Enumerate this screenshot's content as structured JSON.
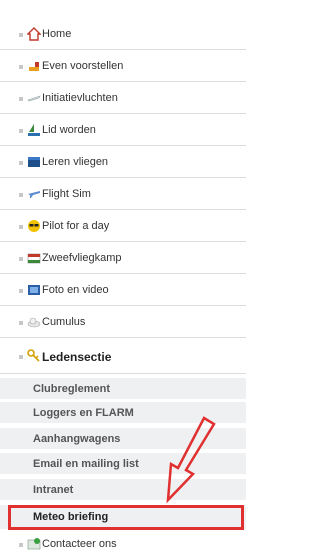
{
  "menu": {
    "items": [
      {
        "label": "Home",
        "icon": "house-icon"
      },
      {
        "label": "Even voorstellen",
        "icon": "plane-icon"
      },
      {
        "label": "Initiatievluchten",
        "icon": "glider-icon"
      },
      {
        "label": "Lid worden",
        "icon": "sailboat-icon"
      },
      {
        "label": "Leren vliegen",
        "icon": "book-icon"
      },
      {
        "label": "Flight Sim",
        "icon": "airplane-icon"
      },
      {
        "label": "Pilot for a day",
        "icon": "sunglasses-icon"
      },
      {
        "label": "Zweefvliegkamp",
        "icon": "flag-icon"
      },
      {
        "label": "Foto en video",
        "icon": "photo-icon"
      },
      {
        "label": "Cumulus",
        "icon": "cloud-icon"
      },
      {
        "label": "Ledensectie",
        "icon": "key-icon"
      },
      {
        "label": "Contacteer ons",
        "icon": "contact-icon"
      }
    ],
    "subitems": [
      {
        "label": "Clubreglement"
      },
      {
        "label": "Loggers en FLARM"
      },
      {
        "label": "Aanhangwagens"
      },
      {
        "label": "Email en mailing list"
      },
      {
        "label": "Intranet"
      },
      {
        "label": "Meteo briefing"
      }
    ]
  },
  "colors": {
    "highlight": "#e03030",
    "subitem_bg": "#eef0f2"
  }
}
